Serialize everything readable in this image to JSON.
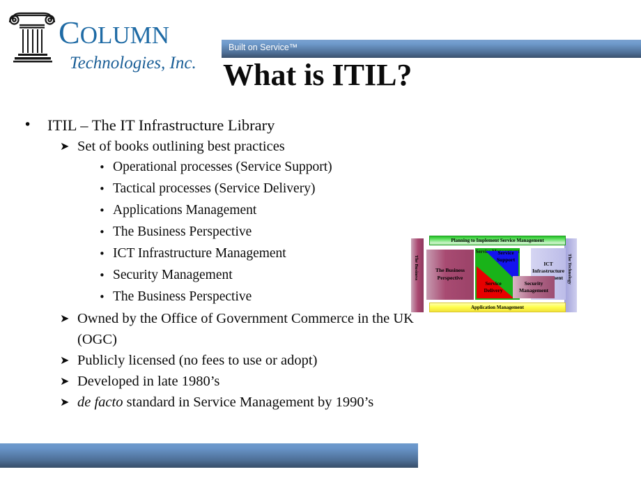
{
  "logo": {
    "icon": "ionic-column-icon",
    "main_text": "Column",
    "main_cap": "C",
    "main_rest": "OLUMN",
    "sub_text": "Technologies, Inc.",
    "brand_color": "#1f6ba5"
  },
  "header": {
    "tagline": "Built on Service™",
    "gradient_top": "#7aa2d0",
    "gradient_bottom": "#384f6b"
  },
  "title": "What is ITIL?",
  "body": {
    "bullets": [
      {
        "level": 1,
        "marker": "•",
        "text": "ITIL – The IT Infrastructure Library"
      },
      {
        "level": 2,
        "marker": "➤",
        "text": "Set of books outlining best practices"
      },
      {
        "level": 3,
        "marker": "•",
        "text": "Operational processes (Service Support)"
      },
      {
        "level": 3,
        "marker": "•",
        "text": "Tactical processes (Service Delivery)"
      },
      {
        "level": 3,
        "marker": "•",
        "text": "Applications Management"
      },
      {
        "level": 3,
        "marker": "•",
        "text": "The Business Perspective"
      },
      {
        "level": 3,
        "marker": "•",
        "text": "ICT Infrastructure Management"
      },
      {
        "level": 3,
        "marker": "•",
        "text": "Security Management"
      },
      {
        "level": 3,
        "marker": "•",
        "text": "The Business Perspective"
      },
      {
        "level": 2,
        "marker": "➤",
        "text": "Owned by the Office of Government Commerce in the UK (OGC)"
      },
      {
        "level": 2,
        "marker": "➤",
        "text": "Publicly licensed (no fees to use or adopt)"
      },
      {
        "level": 2,
        "marker": "➤",
        "text": "Developed in late 1980’s"
      },
      {
        "level": 2,
        "marker": "➤",
        "italic_lead": "de facto",
        "text": " standard in Service Management by 1990’s"
      }
    ]
  },
  "diagram": {
    "name": "itil-framework-diagram",
    "top_bar": "Planning to Implement Service Management",
    "bottom_bar": "Application Management",
    "left_vertical": "The Business",
    "right_vertical": "The Technology",
    "business_perspective": "The Business Perspective",
    "ict": "ICT Infrastructure Management",
    "service_support": "Service Support",
    "service_delivery": "Service Delivery",
    "security": "Security Management",
    "hidden_center": "Service Management",
    "colors": {
      "top_bar": "#63e063",
      "bottom_bar": "#ffff4d",
      "business": "#a84b72",
      "technology": "#bcbce8",
      "core": "#19b319",
      "support": "#1414ee",
      "delivery": "#e60000",
      "security": "#b36c8c"
    }
  },
  "footer": {
    "gradient_top": "#6e9bcd",
    "gradient_bottom": "#374d68"
  }
}
